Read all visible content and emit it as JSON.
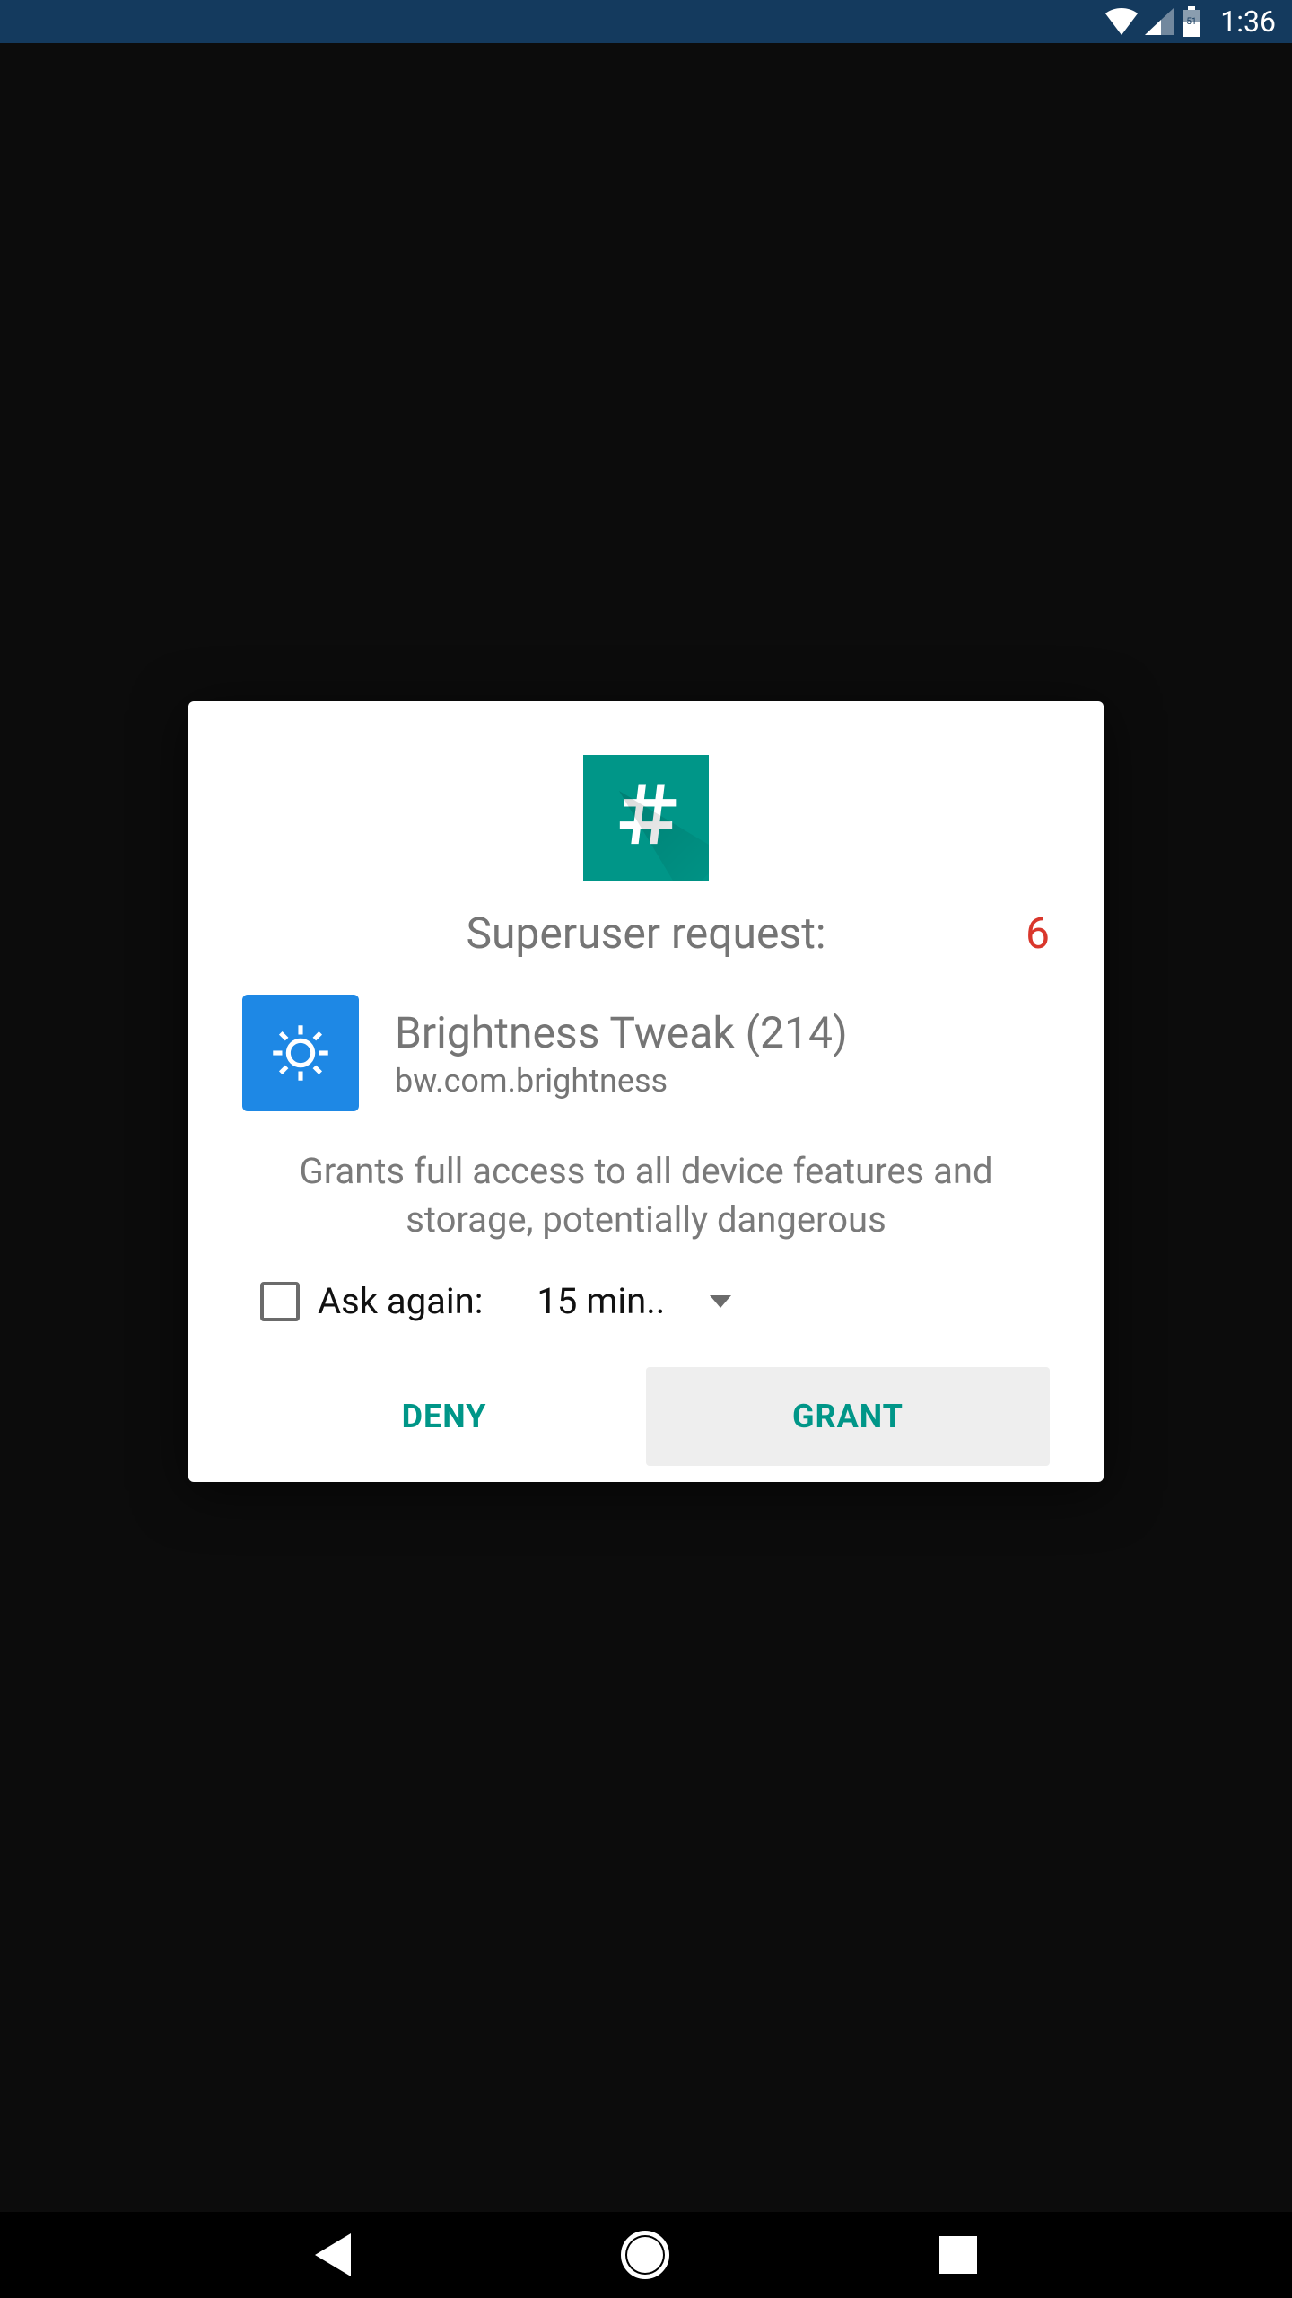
{
  "status_bar": {
    "time": "1:36",
    "battery_level": "51"
  },
  "dialog": {
    "title": "Superuser request:",
    "countdown": "6",
    "app": {
      "name": "Brightness Tweak (214)",
      "package": "bw.com.brightness"
    },
    "warning": "Grants full access to all device features and storage, potentially dangerous",
    "ask_again": {
      "label": "Ask again:",
      "selected": "15 min.."
    },
    "buttons": {
      "deny": "DENY",
      "grant": "GRANT"
    }
  }
}
